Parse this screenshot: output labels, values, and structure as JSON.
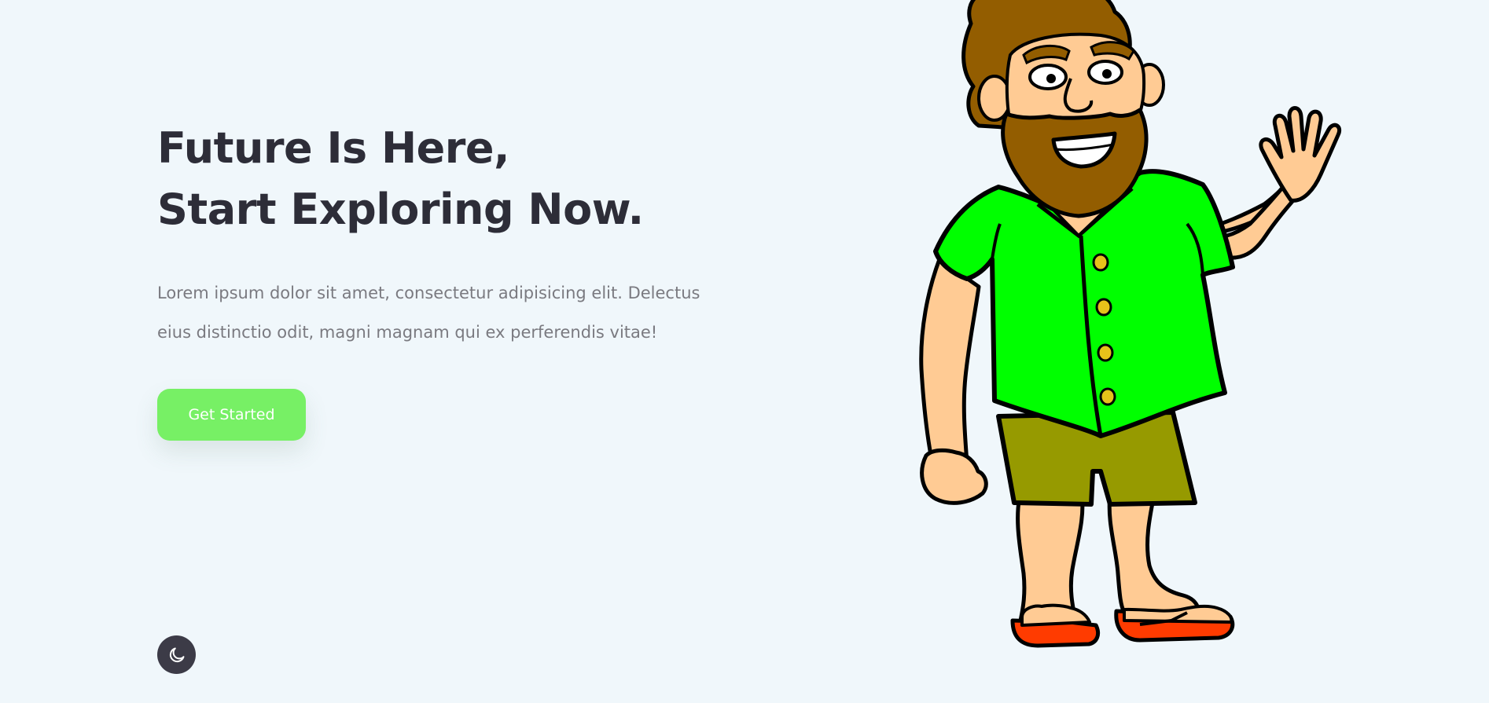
{
  "hero": {
    "title_line_1": "Future Is Here,",
    "title_line_2": "Start Exploring Now.",
    "description_line_1": "Lorem ipsum dolor sit amet, consectetur adipisicing elit. Delectus",
    "description_line_2": "eius distinctio odit, magni magnam qui ex perferendis vitae!",
    "cta_label": "Get Started"
  },
  "theme_toggle": {
    "icon": "moon-icon"
  },
  "illustration": {
    "subject": "waving-cartoon-man"
  },
  "colors": {
    "background": "#f0f7fb",
    "heading": "#2d2d38",
    "body_text": "#7a7a80",
    "accent": "#77f065",
    "toggle_bg": "#3c3b47"
  }
}
